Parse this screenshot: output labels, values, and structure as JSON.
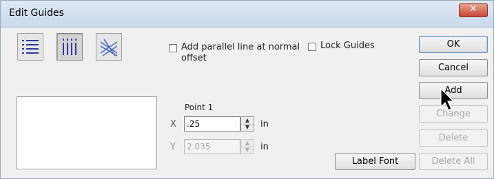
{
  "window": {
    "title": "Edit Guides",
    "close_label": "✕"
  },
  "mode_buttons": [
    {
      "name": "horizontal-guides",
      "icon": "horizontal-lines-icon",
      "selected": false
    },
    {
      "name": "vertical-guides",
      "icon": "vertical-lines-icon",
      "selected": true
    },
    {
      "name": "angled-guides",
      "icon": "angled-lines-icon",
      "selected": false
    }
  ],
  "options": {
    "parallel_line_label_1": "Add parallel line at normal",
    "parallel_line_label_2": "offset",
    "parallel_line_checked": false,
    "lock_guides_label": "Lock Guides",
    "lock_guides_checked": false
  },
  "point": {
    "heading": "Point 1",
    "x_label": "X",
    "x_value": ".25",
    "y_label": "Y",
    "y_value": "2.035",
    "unit": "in"
  },
  "buttons": {
    "ok": "OK",
    "cancel": "Cancel",
    "add": "Add",
    "change": "Change",
    "delete": "Delete",
    "delete_all": "Delete All",
    "label_font": "Label Font"
  }
}
